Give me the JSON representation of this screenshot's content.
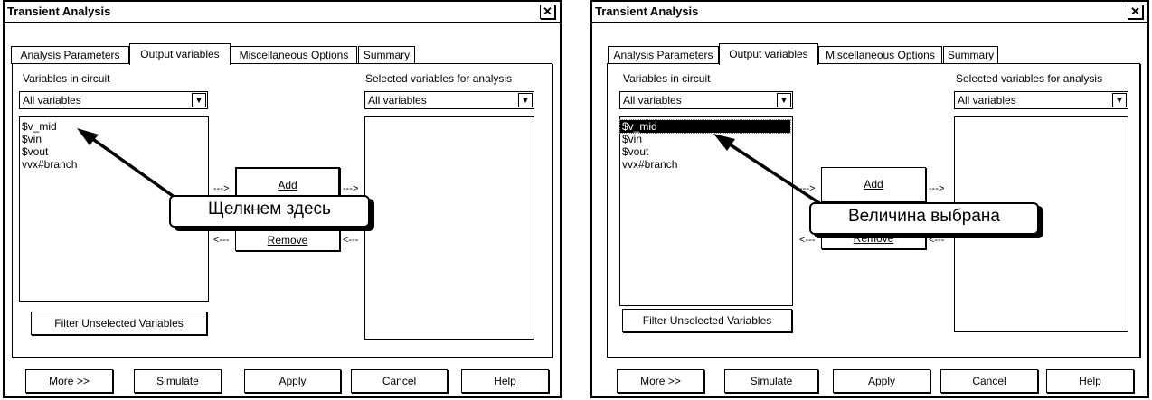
{
  "dialogs": [
    {
      "title": "Transient Analysis",
      "tabs": [
        "Analysis Parameters",
        "Output variables",
        "Miscellaneous Options",
        "Summary"
      ],
      "active_tab": "Output variables",
      "variables_label": "Variables in circuit",
      "variables_filter": "All variables",
      "variables": [
        "$v_mid",
        "$vin",
        "$vout",
        "vvx#branch"
      ],
      "selected_item": "",
      "selected_label": "Selected variables for analysis",
      "selected_filter": "All variables",
      "add_label": "Add",
      "remove_label": "Remove",
      "arrow_right": "--->",
      "arrow_left": "<---",
      "filter_button": "Filter Unselected Variables",
      "callout": "Щелкнем здесь",
      "buttons": [
        "More >>",
        "Simulate",
        "Apply",
        "Cancel",
        "Help"
      ]
    },
    {
      "title": "Transient Analysis",
      "tabs": [
        "Analysis Parameters",
        "Output variables",
        "Miscellaneous Options",
        "Summary"
      ],
      "active_tab": "Output variables",
      "variables_label": "Variables in circuit",
      "variables_filter": "All variables",
      "variables": [
        "$v_mid",
        "$vin",
        "$vout",
        "vvx#branch"
      ],
      "selected_item": "$v_mid",
      "selected_label": "Selected variables for analysis",
      "selected_filter": "All variables",
      "add_label": "Add",
      "remove_label": "Remove",
      "arrow_right": "--->",
      "arrow_left": "<---",
      "filter_button": "Filter Unselected Variables",
      "callout": "Величина выбрана",
      "buttons": [
        "More >>",
        "Simulate",
        "Apply",
        "Cancel",
        "Help"
      ]
    }
  ],
  "icons": {
    "close": "close-icon",
    "dropdown": "chevron-down-icon"
  }
}
